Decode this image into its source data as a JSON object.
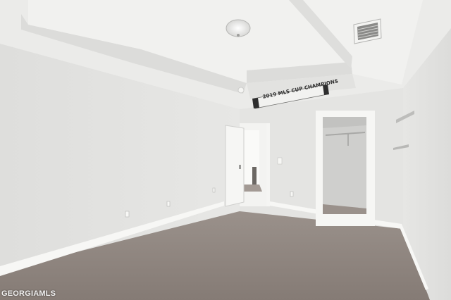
{
  "scene": {
    "description_type": "empty-bedroom-photo",
    "banner_text": "2019 MLS CUP CHAMPIONS",
    "watermark_text": "GEORGIAMLS",
    "colors": {
      "wall": "#e3e3e1",
      "ceiling": "#ececea",
      "carpet": "#8f857f",
      "trim": "#f7f7f5",
      "closet_interior": "#cfcfcd"
    }
  }
}
